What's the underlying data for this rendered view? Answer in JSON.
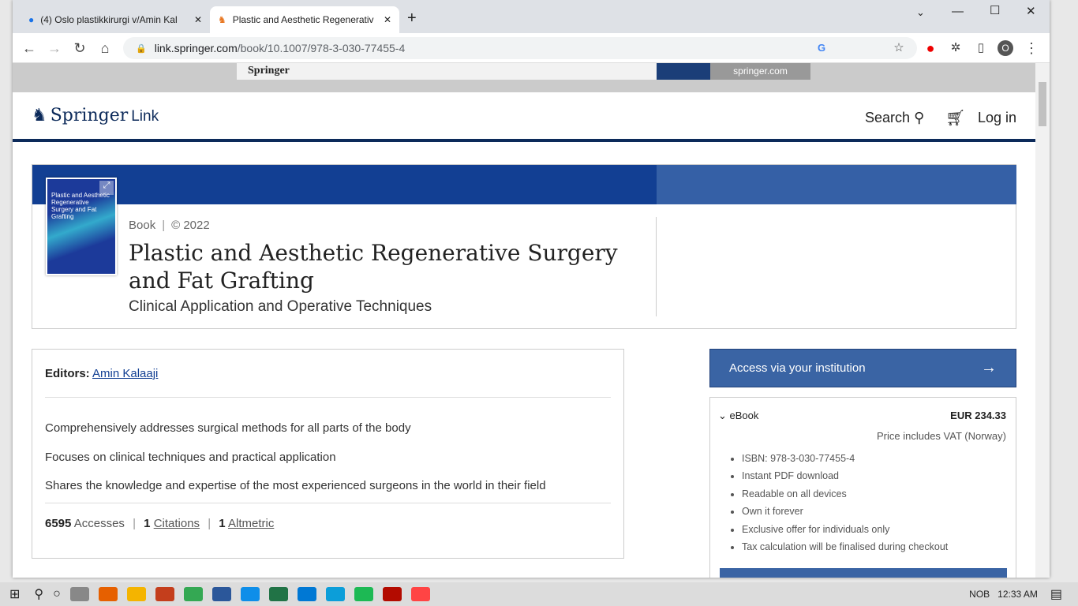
{
  "browser": {
    "tabs": [
      {
        "title": "(4) Oslo plastikkirurgi v/Amin Kal"
      },
      {
        "title": "Plastic and Aesthetic Regenerativ"
      }
    ],
    "url_host": "link.springer.com",
    "url_path": "/book/10.1007/978-3-030-77455-4",
    "profile_initial": "O"
  },
  "ad": {
    "brand": "Springer",
    "site": "springer.com"
  },
  "header": {
    "logo_main": "Springer",
    "logo_sub": "Link",
    "search": "Search",
    "login": "Log in"
  },
  "book": {
    "type": "Book",
    "year": "© 2022",
    "title": "Plastic and Aesthetic Regenerative Surgery and Fat Grafting",
    "subtitle": "Clinical Application and Operative Techniques",
    "cover_title": "Plastic and Aesthetic Regenerative Surgery and Fat Grafting"
  },
  "editors": {
    "label": "Editors:",
    "name": "Amin Kalaaji"
  },
  "highlights": [
    "Comprehensively addresses surgical methods for all parts of the body",
    "Focuses on clinical techniques and practical application",
    "Shares the knowledge and expertise of the most experienced surgeons in the world in their field"
  ],
  "metrics": {
    "accesses": "6595",
    "accesses_label": "Accesses",
    "citations": "1",
    "citations_label": "Citations",
    "altmetric": "1",
    "altmetric_label": "Altmetric"
  },
  "purchase": {
    "access_label": "Access via your institution",
    "ebook_label": "eBook",
    "price": "EUR 234.33",
    "vat": "Price includes VAT (Norway)",
    "features": [
      "ISBN: 978-3-030-77455-4",
      "Instant PDF download",
      "Readable on all devices",
      "Own it forever",
      "Exclusive offer for individuals only",
      "Tax calculation will be finalised during checkout"
    ]
  },
  "taskbar": {
    "lang": "NOB",
    "time": "12:33 AM"
  },
  "colors": {
    "springer_blue": "#123f93",
    "access": "#3a64a4"
  }
}
